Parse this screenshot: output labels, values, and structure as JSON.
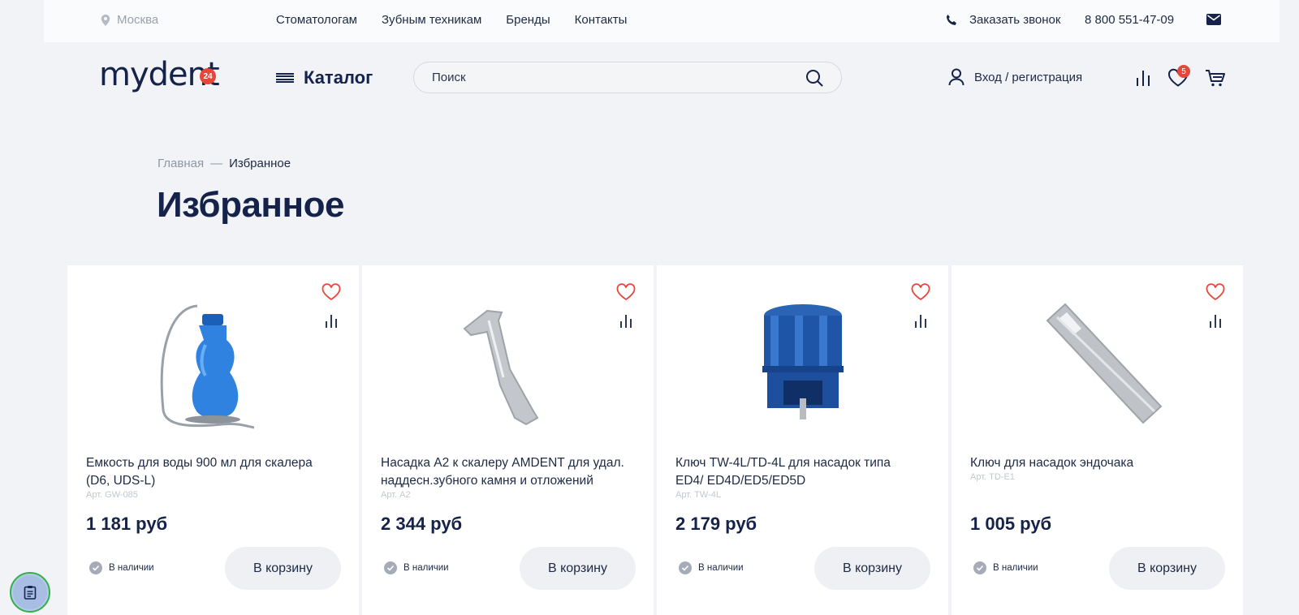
{
  "topbar": {
    "city": "Москва",
    "nav": [
      "Стоматологам",
      "Зубным техникам",
      "Бренды",
      "Контакты"
    ],
    "callback": "Заказать звонок",
    "phone": "8 800 551-47-09"
  },
  "header": {
    "logo_text": "mydent",
    "logo_badge": "24",
    "catalog_label": "Каталог",
    "search_placeholder": "Поиск",
    "login_label": "Вход / регистрация",
    "favorites_count": "5"
  },
  "breadcrumb": {
    "home": "Главная",
    "separator": "—",
    "current": "Избранное"
  },
  "page_title": "Избранное",
  "products": [
    {
      "name": "Емкость для воды 900 мл для скалера (D6, UDS-L)",
      "sku": "Арт. GW-085",
      "price": "1 181 руб",
      "stock": "В наличии",
      "button": "В корзину",
      "image": "water-bottle"
    },
    {
      "name": "Насадка А2 к скалеру AMDENT для удал. наддесн.зубного камня и отложений",
      "sku": "Арт. A2",
      "price": "2 344 руб",
      "stock": "В наличии",
      "button": "В корзину",
      "image": "scaler-tip"
    },
    {
      "name": "Ключ TW-4L/TD-4L для насадок типа ED4/ ED4D/ED5/ED5D",
      "sku": "Арт. TW-4L",
      "price": "2 179 руб",
      "stock": "В наличии",
      "button": "В корзину",
      "image": "torque-wrench"
    },
    {
      "name": "Ключ для насадок эндочака",
      "sku": "Арт. TD-E1",
      "price": "1 005 руб",
      "stock": "В наличии",
      "button": "В корзину",
      "image": "endochuck-key"
    }
  ],
  "colors": {
    "accent_red": "#e8463b",
    "dark_blue": "#15224a",
    "text": "#1d2a44",
    "muted": "#9aa1ad"
  }
}
